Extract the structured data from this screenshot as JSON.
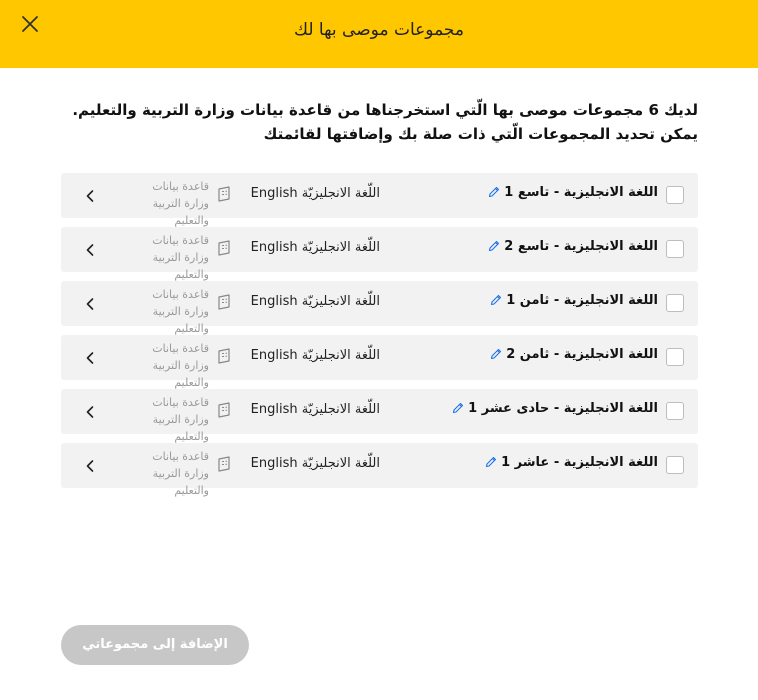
{
  "header": {
    "title": "مجموعات موصى بها لك",
    "close_icon": "close-icon",
    "background_color": "#ffc700"
  },
  "intro": {
    "line1": "لديك 6 مجموعات موصى بها الّتي استخرجناها من قاعدة بيانات وزارة التربية والتعليم.",
    "line2": "يمكن تحديد المجموعات الّتي ذات صلة بك وإضافتها لقائمتك"
  },
  "groups": [
    {
      "name": "اللغة الانجليزية - تاسع 1",
      "subject": "اللّغة الانجليزيّة English",
      "source": "قاعدة بيانات وزارة التربية والتعليم",
      "checked": false
    },
    {
      "name": "اللغة الانجليزية - تاسع 2",
      "subject": "اللّغة الانجليزيّة English",
      "source": "قاعدة بيانات وزارة التربية والتعليم",
      "checked": false
    },
    {
      "name": "اللغة الانجليزية - ثامن 1",
      "subject": "اللّغة الانجليزيّة English",
      "source": "قاعدة بيانات وزارة التربية والتعليم",
      "checked": false
    },
    {
      "name": "اللغة الانجليزية - ثامن 2",
      "subject": "اللّغة الانجليزيّة English",
      "source": "قاعدة بيانات وزارة التربية والتعليم",
      "checked": false
    },
    {
      "name": "اللغة الانجليزية - حادى عشر 1",
      "subject": "اللّغة الانجليزيّة English",
      "source": "قاعدة بيانات وزارة التربية والتعليم",
      "checked": false
    },
    {
      "name": "اللغة الانجليزية - عاشر 1",
      "subject": "اللّغة الانجليزيّة English",
      "source": "قاعدة بيانات وزارة التربية والتعليم",
      "checked": false
    }
  ],
  "icons": {
    "edit": "pencil-icon",
    "source": "school-building-icon",
    "open": "chevron-left-icon"
  },
  "footer": {
    "add_button_label": "الإضافة إلى مجموعاتي",
    "add_button_enabled": false
  },
  "colors": {
    "accent": "#ffc700",
    "edit_icon": "#1a73e8",
    "disabled_button": "#c7c7c7",
    "row_background": "#f2f2f2"
  }
}
